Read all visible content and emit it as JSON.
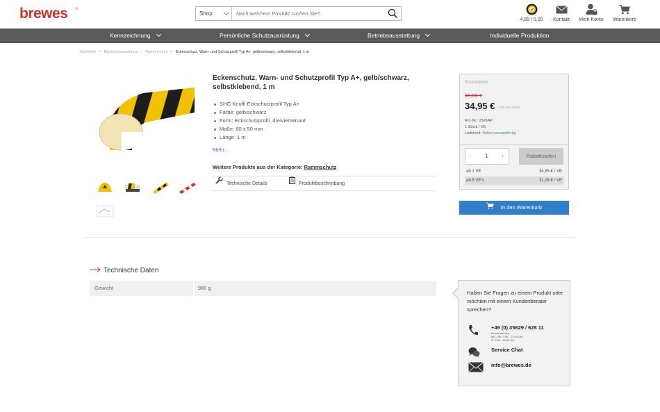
{
  "brand": {
    "logo_text": "brewes",
    "color": "#d0352b"
  },
  "search": {
    "category": "Shop",
    "placeholder": "Nach welchem Produkt suchen Sie?"
  },
  "header_icons": [
    {
      "icon": "rating-seal-icon",
      "label": "4,89 / 5,00"
    },
    {
      "icon": "envelope-icon",
      "label": "Kontakt"
    },
    {
      "icon": "user-lock-icon",
      "label": "Mein Konto"
    },
    {
      "icon": "cart-icon",
      "label": "Warenkorb"
    }
  ],
  "nav": [
    {
      "label": "Kennzeichnung",
      "dropdown": true
    },
    {
      "label": "Persönliche Schutzausrüstung",
      "dropdown": true
    },
    {
      "label": "Betriebsausstattung",
      "dropdown": true
    },
    {
      "label": "Individuelle Produktion",
      "dropdown": false
    }
  ],
  "breadcrumb": [
    "Startseite",
    "Betriebsausstattung",
    "Rammschutz",
    "Eckenschutz, Warn- und Schutzprofil Typ A+, gelb/schwarz, selbstklebend, 1 m"
  ],
  "product": {
    "title": "Eckenschutz, Warn- und Schutzprofil Typ A+, gelb/schwarz, selbstklebend, 1 m",
    "bullets": [
      "SHG Knuffi Eckschutzprofil Typ A+",
      "Farbe: gelb/schwarz",
      "Form: Eckschutzprofil, dreiviertelrund",
      "Maße: 60 x 50 mm",
      "Länge: 1 m"
    ],
    "more_link": "Mehr...",
    "category_label": "Weitere Produkte aus der Kategorie:",
    "category_link": "Rammschutz",
    "tabs": [
      "Technische Details",
      "Produktbeschreibung"
    ]
  },
  "price": {
    "label": "Produktpreis",
    "old": "46,60 €",
    "current": "34,95 €",
    "vat_note": "/ VE exkl. MwSt.",
    "art_nr": "Art.-Nr.: 2326AP",
    "unit": "1 Stück / VE",
    "delivery_label": "Lieferzeit:",
    "delivery_value": "Sofort versandfertig",
    "qty_minus": "-",
    "qty_value": "1",
    "qty_plus": "+",
    "rabatt_button": "Rabattstufen",
    "tiers": [
      {
        "from": "ab 1 VE",
        "price": "34,95 € / VE"
      },
      {
        "from": "ab 5 VE's",
        "price": "31,28 € / VE"
      }
    ],
    "cart_button": "In den Warenkorb"
  },
  "tech": {
    "heading": "Technische Daten",
    "rows": [
      {
        "key": "Gewicht",
        "value": "980 g"
      }
    ]
  },
  "help": {
    "question": "Haben Sie Fragen zu einem Produkt oder möchten mit einem Kundenberater sprechen?",
    "phone": "+49 (0) 35829 / 628 11",
    "phone_sub1": "Kundenservice",
    "phone_sub2": "Mo - Do:  7:00 - 17:00 Uhr",
    "phone_sub3": "Fr          7:00 - 16:00 Uhr",
    "chat": "Service Chat",
    "email": "info@brewes.de"
  },
  "colors": {
    "nav_bg": "#5a5a5a",
    "cart_button": "#2f7fcd",
    "old_price": "#d0352b",
    "in_stock": "#3aa03a"
  }
}
